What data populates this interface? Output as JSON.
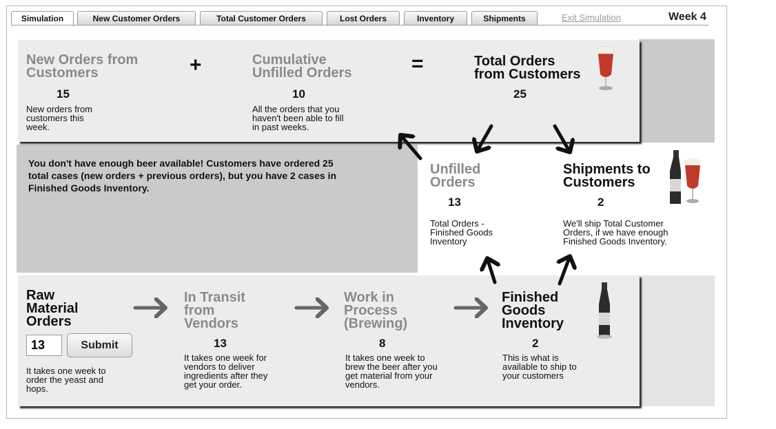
{
  "tabs": [
    "Simulation",
    "New Customer Orders",
    "Total Customer Orders",
    "Lost Orders",
    "Inventory",
    "Shipments"
  ],
  "exit_link": "Exit Simulation",
  "week": "Week 4",
  "orders": {
    "new_title_1": "New Orders from",
    "new_title_2": "Customers",
    "new_value": "15",
    "new_desc": [
      "New orders from",
      "customers this",
      "week."
    ],
    "plus": "+",
    "cum_title_1": "Cumulative",
    "cum_title_2": "Unfilled Orders",
    "cum_value": "10",
    "cum_desc": [
      "All the orders that you",
      "haven't been able to fill",
      "in past weeks."
    ],
    "equals": "=",
    "total_title_1": "Total Orders",
    "total_title_2": "from Customers",
    "total_value": "25"
  },
  "message": [
    "You don't have enough beer available! Customers have ordered 25",
    "total cases (new orders + previous orders), but you have 2 cases in",
    "Finished Goods Inventory."
  ],
  "unfilled": {
    "title_1": "Unfilled",
    "title_2": "Orders",
    "value": "13",
    "desc": [
      "Total Orders -",
      "Finished Goods",
      "Inventory"
    ]
  },
  "shipments": {
    "title_1": "Shipments to",
    "title_2": "Customers",
    "value": "2",
    "desc": [
      "We'll ship Total Customer",
      "Orders, if we have enough",
      "Finished Goods Inventory."
    ]
  },
  "raw": {
    "title": [
      "Raw",
      "Material",
      "Orders"
    ],
    "input_value": "13",
    "submit_label": "Submit",
    "desc": [
      "It takes one week to",
      "order the yeast and",
      "hops."
    ]
  },
  "transit": {
    "title": [
      "In Transit",
      "from",
      "Vendors"
    ],
    "value": "13",
    "desc": [
      "It takes one week for",
      "vendors to deliver",
      "ingredients after they",
      "get your order."
    ]
  },
  "wip": {
    "title": [
      "Work in",
      "Process",
      "(Brewing)"
    ],
    "value": "8",
    "desc": [
      "It takes one week to",
      "brew the beer after you",
      "get material from your",
      "vendors."
    ]
  },
  "finished": {
    "title": [
      "Finished",
      "Goods",
      "Inventory"
    ],
    "value": "2",
    "desc": [
      "This is what is",
      "available to ship to",
      "your customers"
    ]
  },
  "colors": {
    "panel": "#ececec",
    "gray_block": "#cacaca",
    "muted_heading": "#8a8a8a",
    "beer": "#c0392b"
  },
  "icons": [
    "beer-glass-icon",
    "beer-bottle-and-glass-icon",
    "beer-bottle-icon"
  ]
}
